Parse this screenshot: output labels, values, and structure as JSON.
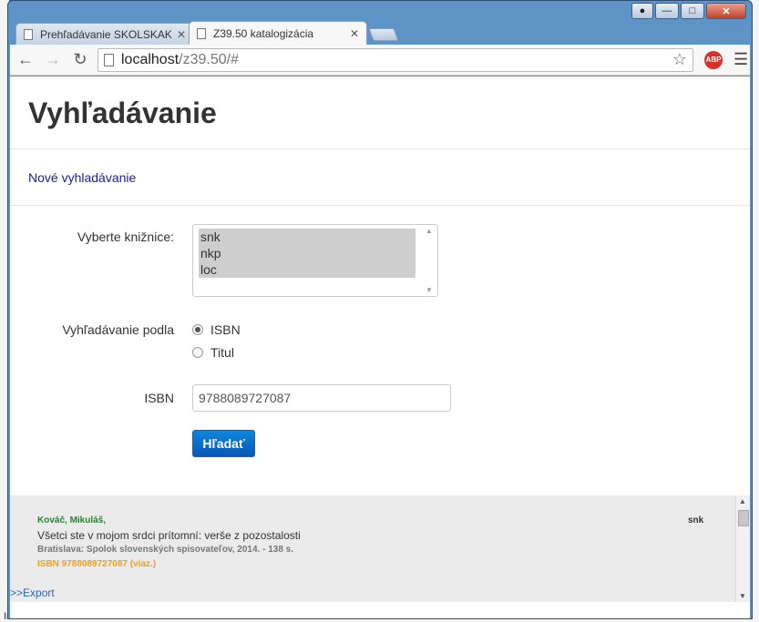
{
  "browser": {
    "tabs": [
      {
        "title": "Prehľadávanie SKOLSKAKI",
        "active": false
      },
      {
        "title": "Z39.50 katalogizácia",
        "active": true
      }
    ],
    "url_host": "localhost",
    "url_path": "/z39.50/#",
    "abp_label": "ABP"
  },
  "page": {
    "title": "Vyhľadávanie",
    "new_search_link": "Nové vyhladávanie"
  },
  "form": {
    "libraries_label": "Vyberte knižnice:",
    "libraries": [
      "snk",
      "nkp",
      "loc"
    ],
    "search_by_label": "Vyhľadávanie podla",
    "search_by_options": [
      {
        "label": "ISBN",
        "checked": true
      },
      {
        "label": "Titul",
        "checked": false
      }
    ],
    "isbn_label": "ISBN",
    "isbn_value": "9788089727087",
    "search_button": "Hľadať"
  },
  "results": [
    {
      "author": "Kováč, Mikuláš,",
      "title": "Všetci ste v mojom srdci prítomní: verše z pozostalosti",
      "publication": "Bratislava: Spolok slovenských spisovateľov, 2014. - 138 s.",
      "isbn": "ISBN 9788089727087 (viaz.)",
      "library": "snk"
    }
  ],
  "export_link": ">>Export",
  "desktop_text": "IrfanView    ~lock.NO..."
}
